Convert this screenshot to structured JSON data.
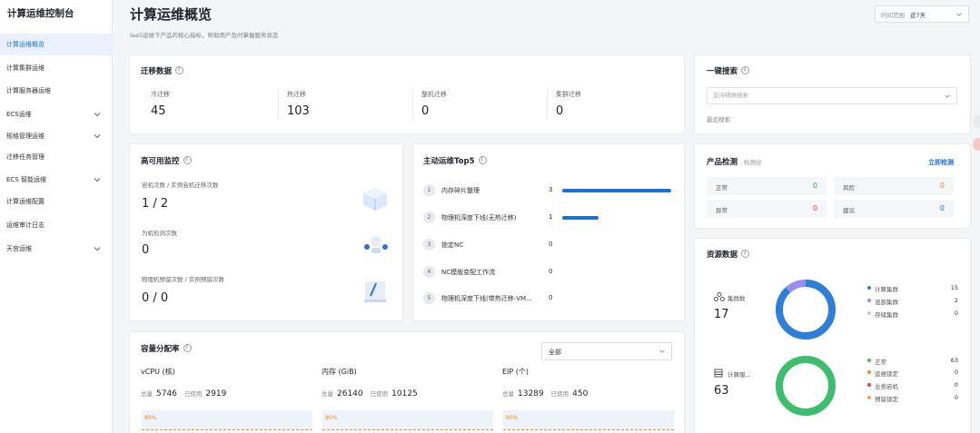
{
  "app": {
    "title": "计算运维控制台"
  },
  "sidebar": {
    "items": [
      {
        "label": "计算运维概览",
        "active": true,
        "expandable": false
      },
      {
        "label": "计算集群运维",
        "active": false,
        "expandable": false
      },
      {
        "label": "计算服务器运维",
        "active": false,
        "expandable": false
      },
      {
        "label": "ECS运维",
        "active": false,
        "expandable": true
      },
      {
        "label": "规格管理运维",
        "active": false,
        "expandable": true
      },
      {
        "label": "迁移任务管理",
        "active": false,
        "expandable": false
      },
      {
        "label": "ECS 智能运维",
        "active": false,
        "expandable": true
      },
      {
        "label": "计算运维配置",
        "active": false,
        "expandable": false
      },
      {
        "label": "运维审计日志",
        "active": false,
        "expandable": false
      },
      {
        "label": "天宫运维",
        "active": false,
        "expandable": true
      }
    ]
  },
  "header": {
    "title": "计算运维概览",
    "subtitle": "IaaS运维下产品的核心指标，帮助用户及时掌握服务状态",
    "time_label": "时间范围",
    "time_value": "近7天"
  },
  "migration": {
    "title": "迁移数据",
    "items": [
      {
        "label": "冷迁移",
        "value": "45"
      },
      {
        "label": "热迁移",
        "value": "103"
      },
      {
        "label": "整机迁移",
        "value": "0"
      },
      {
        "label": "集群迁移",
        "value": "0"
      }
    ]
  },
  "ha": {
    "title": "高可用监控",
    "items": [
      {
        "label": "宕机次数 / 实例宕机迁移次数",
        "value": "1 / 2"
      },
      {
        "label": "为机检测次数",
        "value": "0"
      },
      {
        "label": "物理机预留次数 / 实例预留次数",
        "value": "0 / 0"
      }
    ]
  },
  "top5": {
    "title": "主动运维Top5",
    "rows": [
      {
        "rank": "1",
        "name": "内存碎片整理",
        "count": "3",
        "fraction": 1.0
      },
      {
        "rank": "2",
        "name": "物理机深度下线(无热迁移)",
        "count": "1",
        "fraction": 0.33
      },
      {
        "rank": "3",
        "name": "锁定NC",
        "count": "0",
        "fraction": 0
      },
      {
        "rank": "4",
        "name": "NC模版变配工作流",
        "count": "0",
        "fraction": 0
      },
      {
        "rank": "5",
        "name": "物理机深度下线(带热迁移-VM...",
        "count": "0",
        "fraction": 0
      }
    ]
  },
  "capacity": {
    "title": "容量分配率",
    "select_value": "全部",
    "cols": [
      {
        "title": "vCPU (核)",
        "total_label": "总量",
        "total": "5746",
        "used_label": "已使用",
        "used": "2919",
        "rate": "80%"
      },
      {
        "title": "内存 (GiB)",
        "total_label": "总量",
        "total": "26140",
        "used_label": "已使用",
        "used": "10125",
        "rate": "80%"
      },
      {
        "title": "EIP (个)",
        "total_label": "总量",
        "total": "13289",
        "used_label": "已使用",
        "used": "450",
        "rate": "80%"
      }
    ]
  },
  "search": {
    "title": "一键搜索",
    "placeholder": "支持精确搜索",
    "recent_label": "最近搜索"
  },
  "product": {
    "title": "产品检测",
    "subtitle": "检测分",
    "action": "立即检测",
    "cells": [
      {
        "label": "正常",
        "value": "0",
        "color": "#2fa24a"
      },
      {
        "label": "风险",
        "value": "0",
        "color": "#f08a24"
      },
      {
        "label": "异常",
        "value": "0",
        "color": "#e8483b"
      },
      {
        "label": "建议",
        "value": "0",
        "color": "#1a6fd9"
      }
    ]
  },
  "resource": {
    "title": "资源数据",
    "groups": [
      {
        "icon": "cluster-icon",
        "label": "集群数",
        "value": "17",
        "legend": [
          {
            "label": "计算集群",
            "value": "15",
            "color": "#2f7fd8"
          },
          {
            "label": "混部集群",
            "value": "2",
            "color": "#9b8cf0"
          },
          {
            "label": "存储集群",
            "value": "0",
            "color": "#c5cad1"
          }
        ]
      },
      {
        "icon": "server-icon",
        "label": "计算服...",
        "value": "63",
        "legend": [
          {
            "label": "正常",
            "value": "63",
            "color": "#3fbd6e"
          },
          {
            "label": "运维锁定",
            "value": "0",
            "color": "#f08a24"
          },
          {
            "label": "业务宕机",
            "value": "0",
            "color": "#e8483b"
          },
          {
            "label": "预留锁定",
            "value": "0",
            "color": "#f3a33a"
          }
        ]
      }
    ]
  }
}
